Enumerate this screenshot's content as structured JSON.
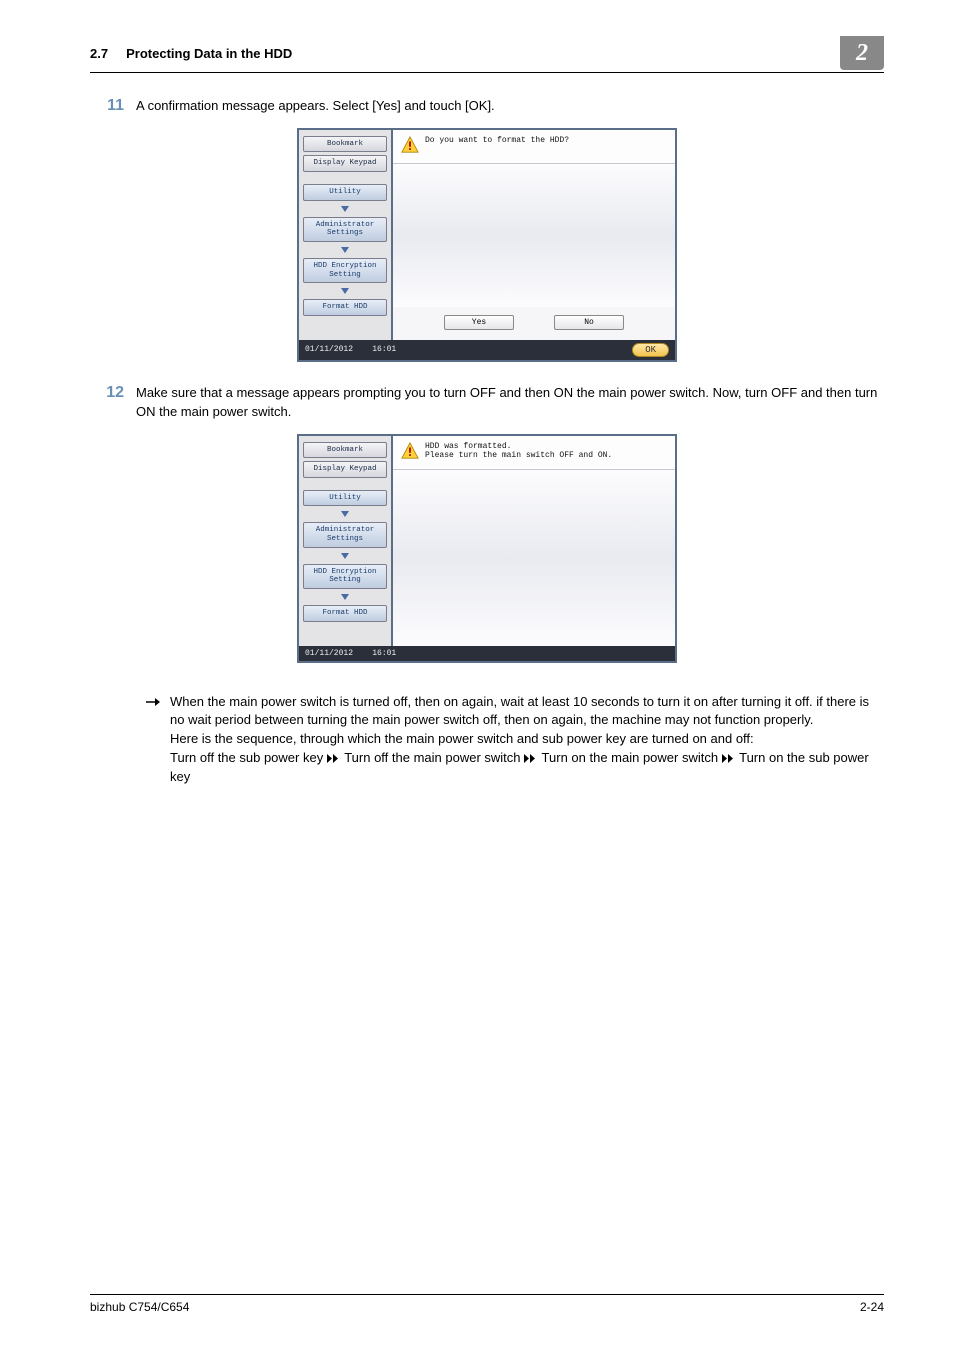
{
  "header": {
    "section_num": "2.7",
    "section_title": "Protecting Data in the HDD",
    "chapter": "2"
  },
  "steps": {
    "s11": {
      "num": "11",
      "text": "A confirmation message appears. Select [Yes] and touch [OK]."
    },
    "s12": {
      "num": "12",
      "text": "Make sure that a message appears prompting you to turn OFF and then ON the main power switch. Now, turn OFF and then turn ON the main power switch."
    }
  },
  "device1": {
    "side": {
      "bookmark": "Bookmark",
      "keypad": "Display Keypad",
      "utility": "Utility",
      "admin": "Administrator\nSettings",
      "enc": "HDD Encryption\nSetting",
      "format": "Format HDD"
    },
    "msg": "Do you want to format the HDD?",
    "yes": "Yes",
    "no": "No",
    "date": "01/11/2012",
    "time": "16:01",
    "ok": "OK"
  },
  "device2": {
    "side": {
      "bookmark": "Bookmark",
      "keypad": "Display Keypad",
      "utility": "Utility",
      "admin": "Administrator\nSettings",
      "enc": "HDD Encryption\nSetting",
      "format": "Format HDD"
    },
    "msg": "HDD was formatted.\nPlease turn the main switch OFF and ON.",
    "date": "01/11/2012",
    "time": "16:01"
  },
  "bullet": {
    "p1": "When the main power switch is turned off, then on again, wait at least 10 seconds to turn it on after turning it off. if there is no wait period between turning the main power switch off, then on again, the machine may not function properly.",
    "p2": "Here is the sequence, through which the main power switch and sub power key are turned on and off:",
    "seq1": "Turn off the sub power key",
    "seq2": "Turn off the main power switch",
    "seq3": "Turn on the main power switch",
    "seq4": "Turn on the sub power key"
  },
  "footer": {
    "left": "bizhub C754/C654",
    "right": "2-24"
  }
}
